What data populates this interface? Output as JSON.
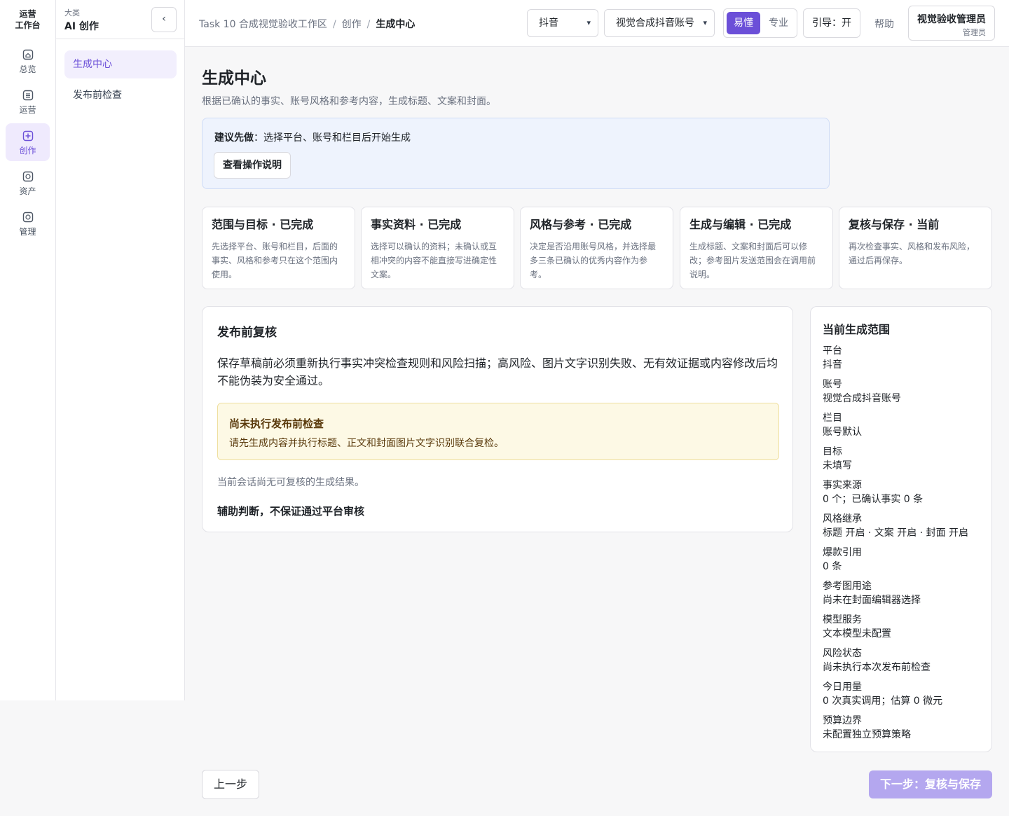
{
  "rail": {
    "title_line1": "运营",
    "title_line2": "工作台",
    "items": [
      {
        "label": "总览",
        "icon": "home-icon"
      },
      {
        "label": "运营",
        "icon": "list-icon"
      },
      {
        "label": "创作",
        "icon": "create-icon"
      },
      {
        "label": "资产",
        "icon": "asset-icon"
      },
      {
        "label": "管理",
        "icon": "manage-icon"
      }
    ]
  },
  "sidebar": {
    "category_label": "大类",
    "category_name": "AI 创作",
    "collapse_icon": "‹",
    "items": [
      {
        "label": "生成中心"
      },
      {
        "label": "发布前检查"
      }
    ]
  },
  "topbar": {
    "breadcrumb": [
      "Task 10 合成视觉验收工作区",
      "创作",
      "生成中心"
    ],
    "breadcrumb_sep": "/",
    "platform_select": "抖音",
    "account_select": "视觉合成抖音账号",
    "mode_easy": "易懂",
    "mode_pro": "专业",
    "guide": "引导：开",
    "help": "帮助",
    "user_name": "视觉验收管理员",
    "user_role": "管理员"
  },
  "main": {
    "title": "生成中心",
    "subtitle": "根据已确认的事实、账号风格和参考内容，生成标题、文案和封面。",
    "tip_bold": "建议先做",
    "tip_text": "：选择平台、账号和栏目后开始生成",
    "tip_button": "查看操作说明",
    "steps": [
      {
        "title": "范围与目标 · 已完成",
        "desc": "先选择平台、账号和栏目，后面的事实、风格和参考只在这个范围内使用。"
      },
      {
        "title": "事实资料 · 已完成",
        "desc": "选择可以确认的资料；未确认或互相冲突的内容不能直接写进确定性文案。"
      },
      {
        "title": "风格与参考 · 已完成",
        "desc": "决定是否沿用账号风格，并选择最多三条已确认的优秀内容作为参考。"
      },
      {
        "title": "生成与编辑 · 已完成",
        "desc": "生成标题、文案和封面后可以修改；参考图片发送范围会在调用前说明。"
      },
      {
        "title": "复核与保存 · 当前",
        "desc": "再次检查事实、风格和发布风险，通过后再保存。"
      }
    ],
    "review": {
      "title": "发布前复核",
      "desc": "保存草稿前必须重新执行事实冲突检查规则和风险扫描；高风险、图片文字识别失败、无有效证据或内容修改后均不能伪装为安全通过。",
      "warn_title": "尚未执行发布前检查",
      "warn_text": "请先生成内容并执行标题、正文和封面图片文字识别联合复检。",
      "empty": "当前会话尚无可复核的生成结果。",
      "note": "辅助判断，不保证通过平台审核"
    },
    "scope": {
      "title": "当前生成范围",
      "rows": [
        {
          "label": "平台",
          "value": "抖音"
        },
        {
          "label": "账号",
          "value": "视觉合成抖音账号"
        },
        {
          "label": "栏目",
          "value": "账号默认"
        },
        {
          "label": "目标",
          "value": "未填写"
        },
        {
          "label": "事实来源",
          "value": "0 个；已确认事实 0 条"
        },
        {
          "label": "风格继承",
          "value": "标题 开启 · 文案 开启 · 封面 开启"
        },
        {
          "label": "爆款引用",
          "value": "0 条"
        },
        {
          "label": "参考图用途",
          "value": "尚未在封面编辑器选择"
        },
        {
          "label": "模型服务",
          "value": "文本模型未配置"
        },
        {
          "label": "风险状态",
          "value": "尚未执行本次发布前检查"
        },
        {
          "label": "今日用量",
          "value": "0 次真实调用；估算 0 微元"
        },
        {
          "label": "预算边界",
          "value": "未配置独立预算策略"
        }
      ]
    },
    "prev_button": "上一步",
    "next_button": "下一步：复核与保存"
  },
  "colors": {
    "accent": "#6b4fd8",
    "accent_light": "#efeafd",
    "tip_bg": "#eef3fd",
    "warn_bg": "#fdf9e5",
    "next_disabled": "#b4a7ef"
  }
}
